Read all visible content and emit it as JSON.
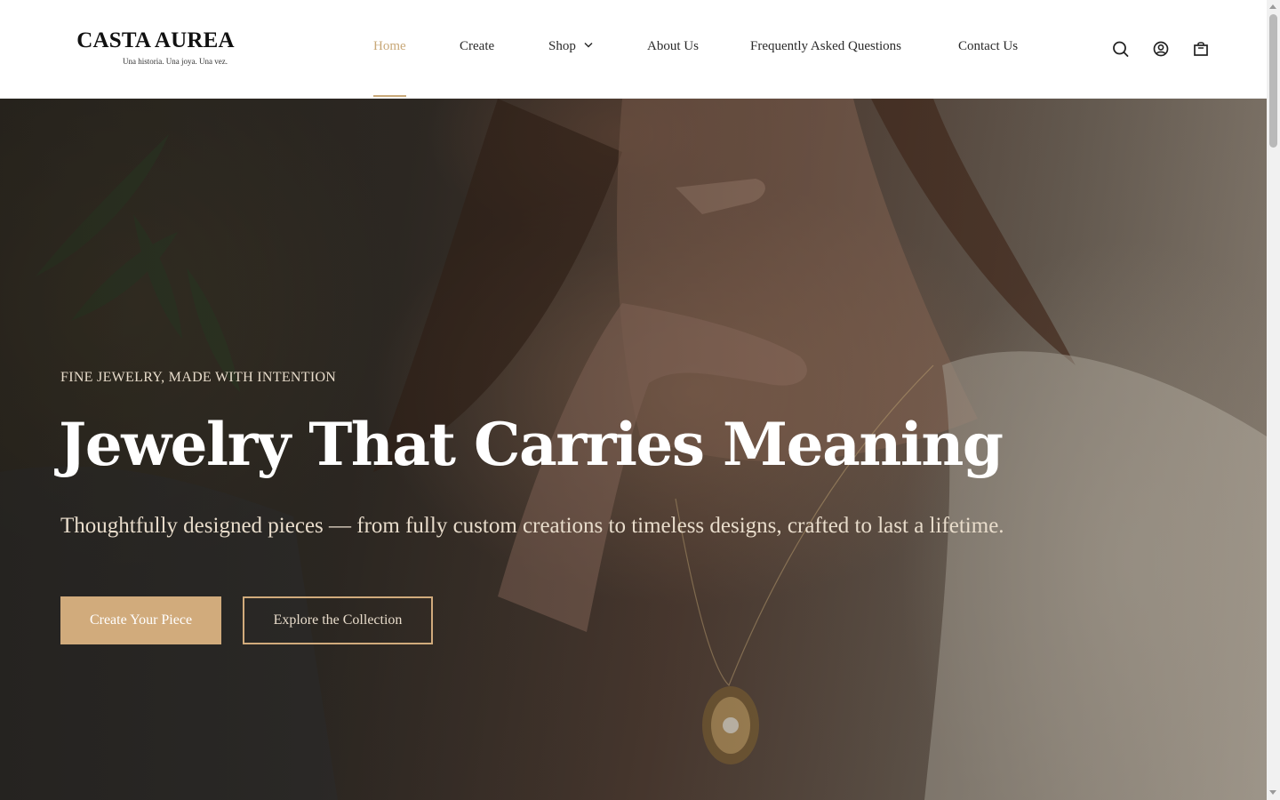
{
  "brand": {
    "name": "CASTA AUREA",
    "tagline": "Una historia. Una joya. Una vez."
  },
  "nav": {
    "items": [
      {
        "label": "Home",
        "active": true
      },
      {
        "label": "Create"
      },
      {
        "label": "Shop",
        "has_dropdown": true
      },
      {
        "label": "About Us"
      },
      {
        "label": "Frequently Asked Questions"
      },
      {
        "label": "Contact Us"
      }
    ]
  },
  "header_icons": [
    "search-icon",
    "account-icon",
    "cart-icon"
  ],
  "hero": {
    "eyebrow": "FINE JEWELRY, MADE WITH INTENTION",
    "title": "Jewelry That Carries Meaning",
    "subtitle": "Thoughtfully designed pieces — from fully custom creations to timeless designs, crafted to last a lifetime.",
    "primary_cta": "Create Your Piece",
    "secondary_cta": "Explore the Collection"
  },
  "colors": {
    "accent": "#c8a878",
    "button_gold": "#d1ab7c",
    "text_dark": "#2a2a2a",
    "hero_text": "#e8dccb"
  }
}
